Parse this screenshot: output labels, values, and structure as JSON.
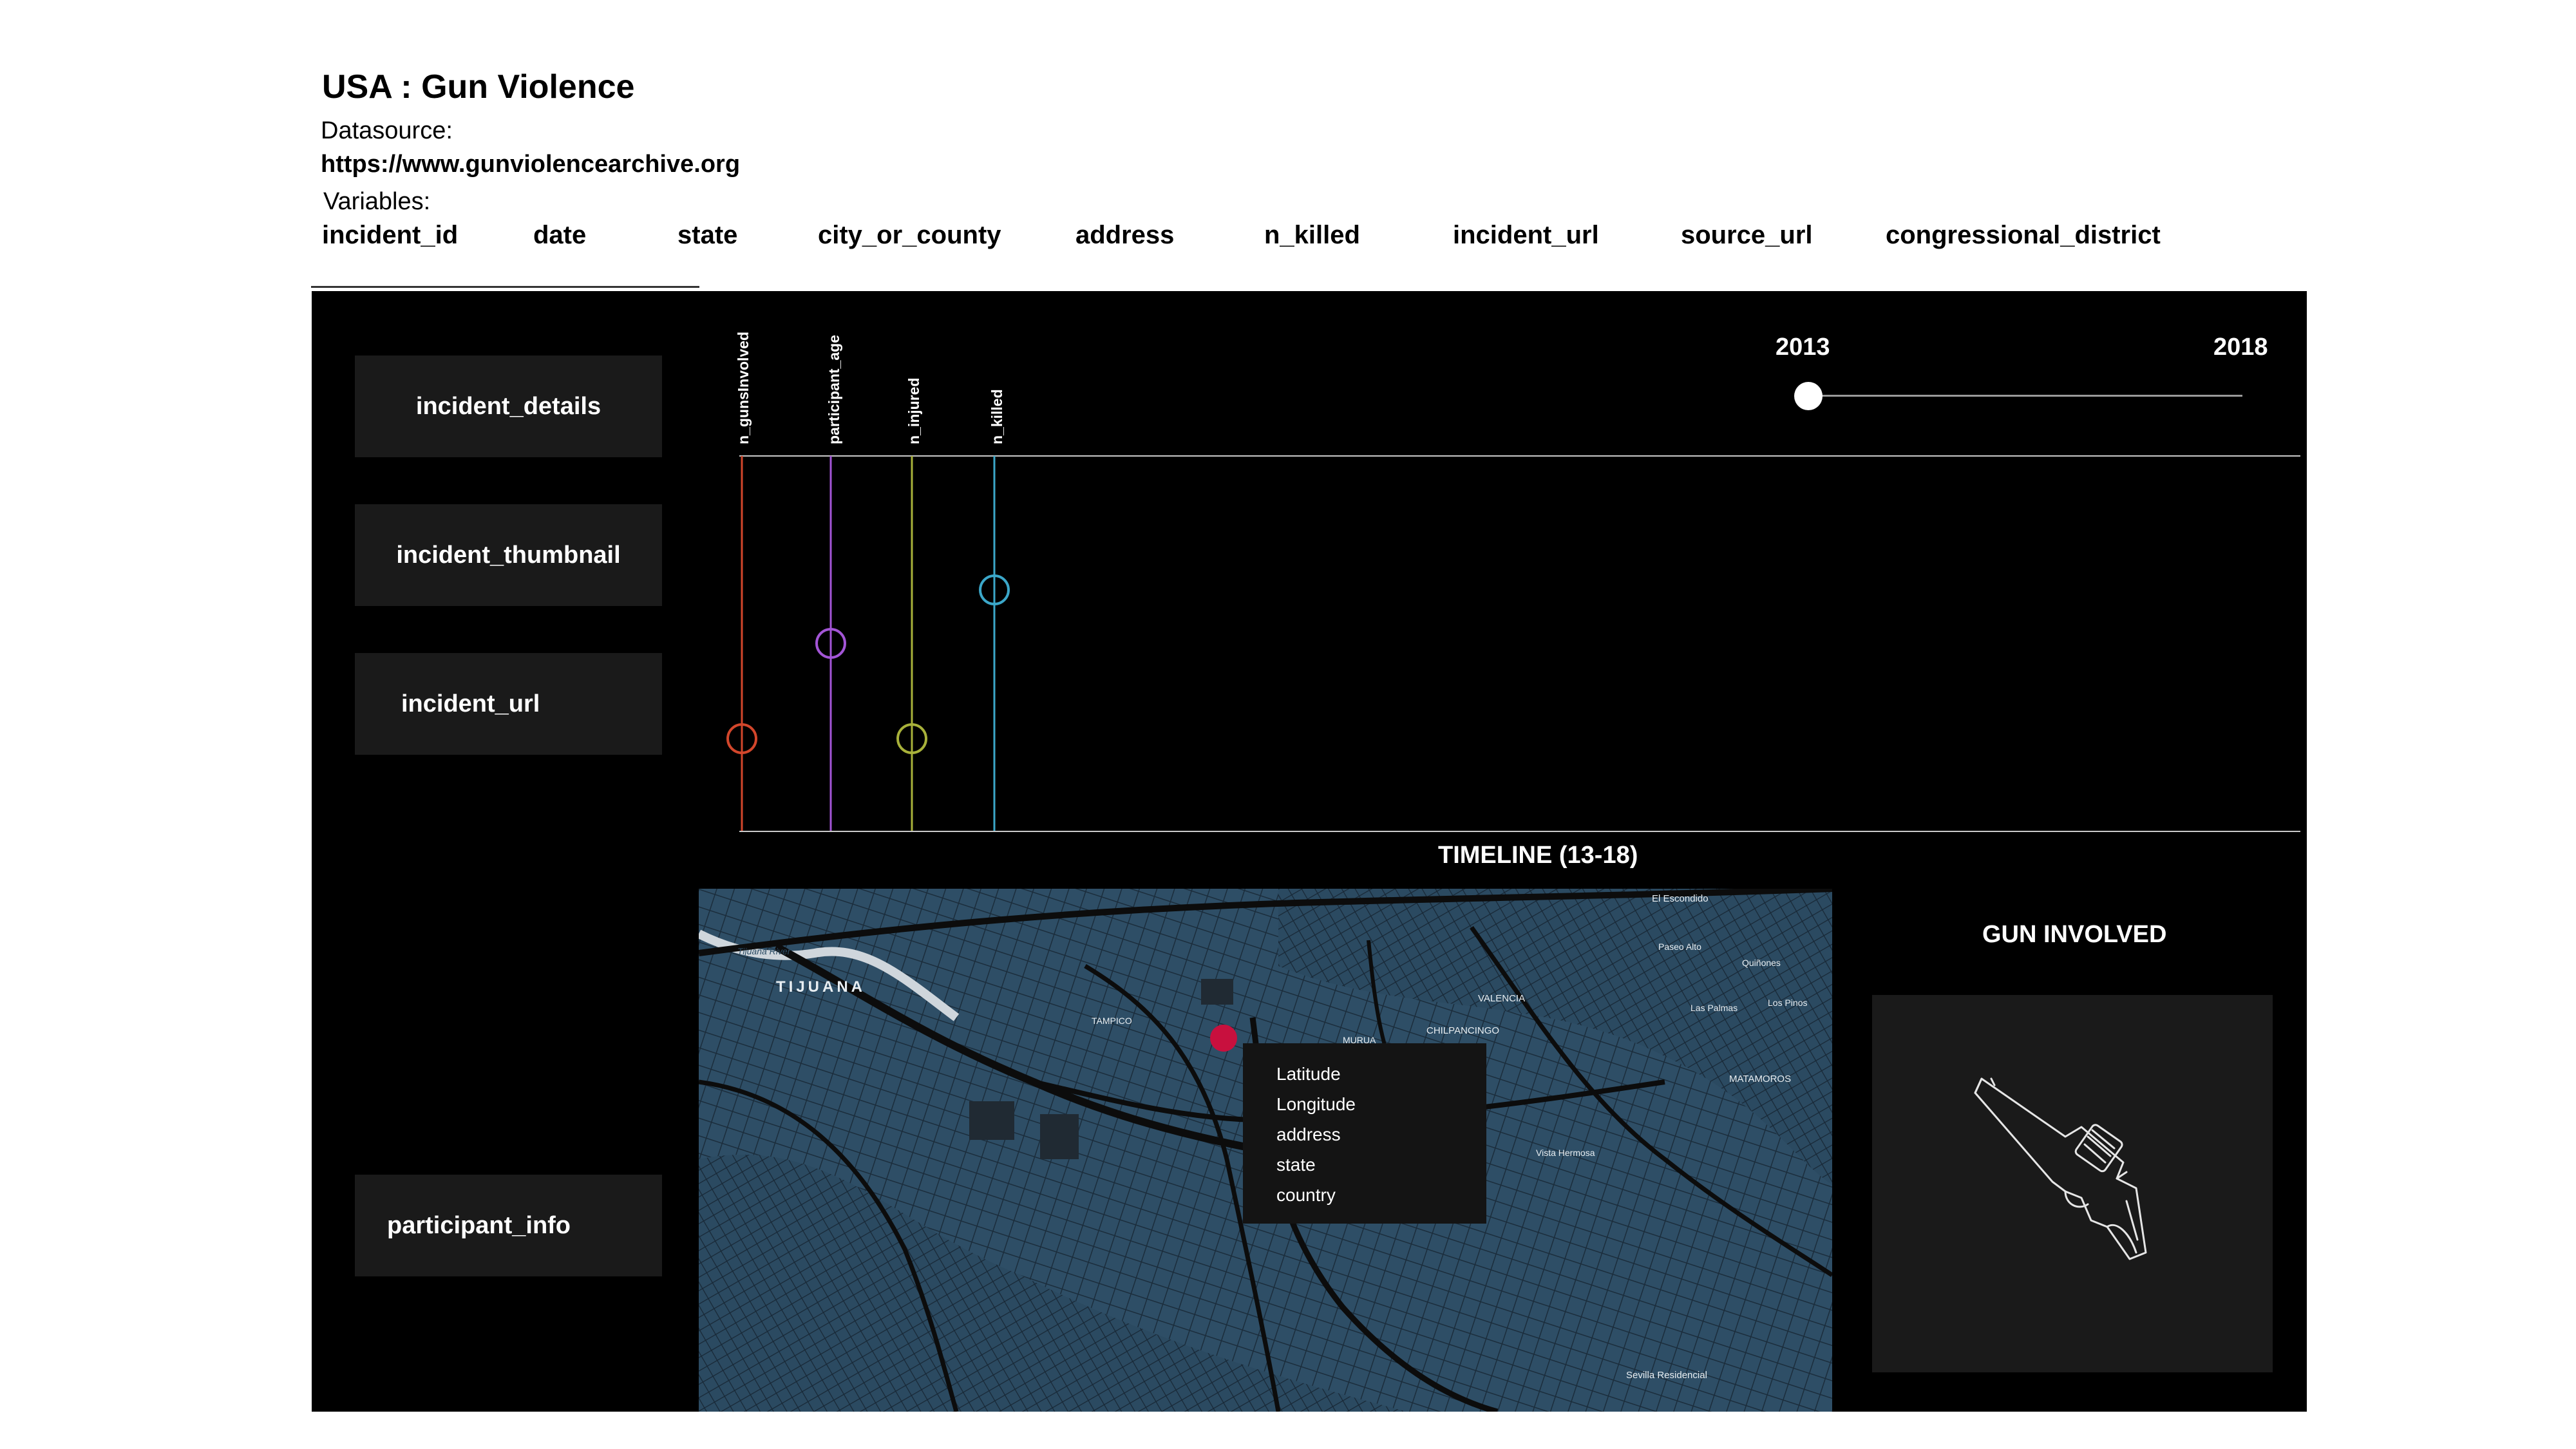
{
  "header": {
    "title": "USA : Gun Violence",
    "datasource_label": "Datasource:",
    "datasource_url": "https://www.gunviolencearchive.org",
    "variables_label": "Variables:",
    "variables": [
      "incident_id",
      "date",
      "state",
      "city_or_county",
      "address",
      "n_killed",
      "incident_url",
      "source_url",
      "congressional_district"
    ]
  },
  "sidebar": {
    "buttons": [
      "incident_details",
      "incident_thumbnail",
      "incident_url",
      "participant_info"
    ]
  },
  "timeline": {
    "year_start": "2013",
    "year_end": "2018",
    "slider_value": "2013",
    "caption": "TIMELINE (13-18)",
    "variables": [
      {
        "name": "n_gunsInvolved",
        "color": "#d2462b"
      },
      {
        "name": "participant_age",
        "color": "#a355d6"
      },
      {
        "name": "n_injured",
        "color": "#a8b13a"
      },
      {
        "name": "n_killed",
        "color": "#3ba7c9"
      }
    ]
  },
  "map": {
    "city_label": "TIJUANA",
    "place_labels": [
      "Tijuana River",
      "TAMPICO",
      "VALENCIA",
      "CHILPANCINGO",
      "MURUA",
      "MATAMOROS",
      "El Escondido",
      "Paseo Alto",
      "Quiñones",
      "Las Palmas",
      "Los Pinos",
      "Sevilla Residencial",
      "Vista Hermosa"
    ],
    "marker_color": "#c8103e",
    "tooltip_fields": [
      "Latitude",
      "Longitude",
      "address",
      "state",
      "country"
    ]
  },
  "gun_panel": {
    "title": "GUN INVOLVED",
    "icon": "revolver-icon"
  }
}
